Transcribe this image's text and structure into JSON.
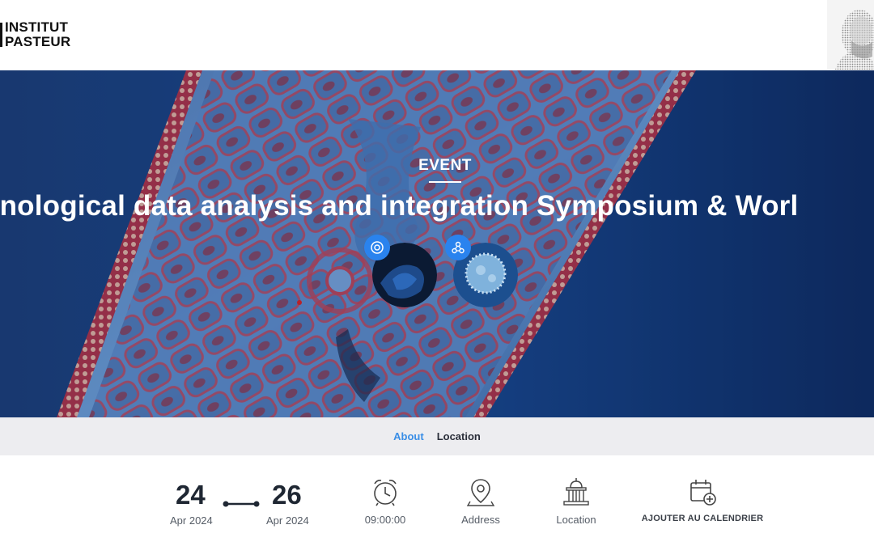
{
  "header": {
    "logo_line1": "INSTITUT",
    "logo_line2": "PASTEUR"
  },
  "hero": {
    "eyebrow": "EVENT",
    "title": "unological data analysis and integration Symposium & Worl",
    "accent_color": "#2a83ee"
  },
  "tabs": [
    {
      "label": "About",
      "active": true
    },
    {
      "label": "Location",
      "active": false
    }
  ],
  "event_info": {
    "start_day": "24",
    "start_month": "Apr 2024",
    "end_day": "26",
    "end_month": "Apr 2024",
    "time": "09:00:00",
    "address_label": "Address",
    "location_label": "Location",
    "calendar_label": "AJOUTER AU CALENDRIER"
  },
  "icons": [
    "clock-icon",
    "map-pin-icon",
    "building-icon",
    "calendar-add-icon"
  ]
}
